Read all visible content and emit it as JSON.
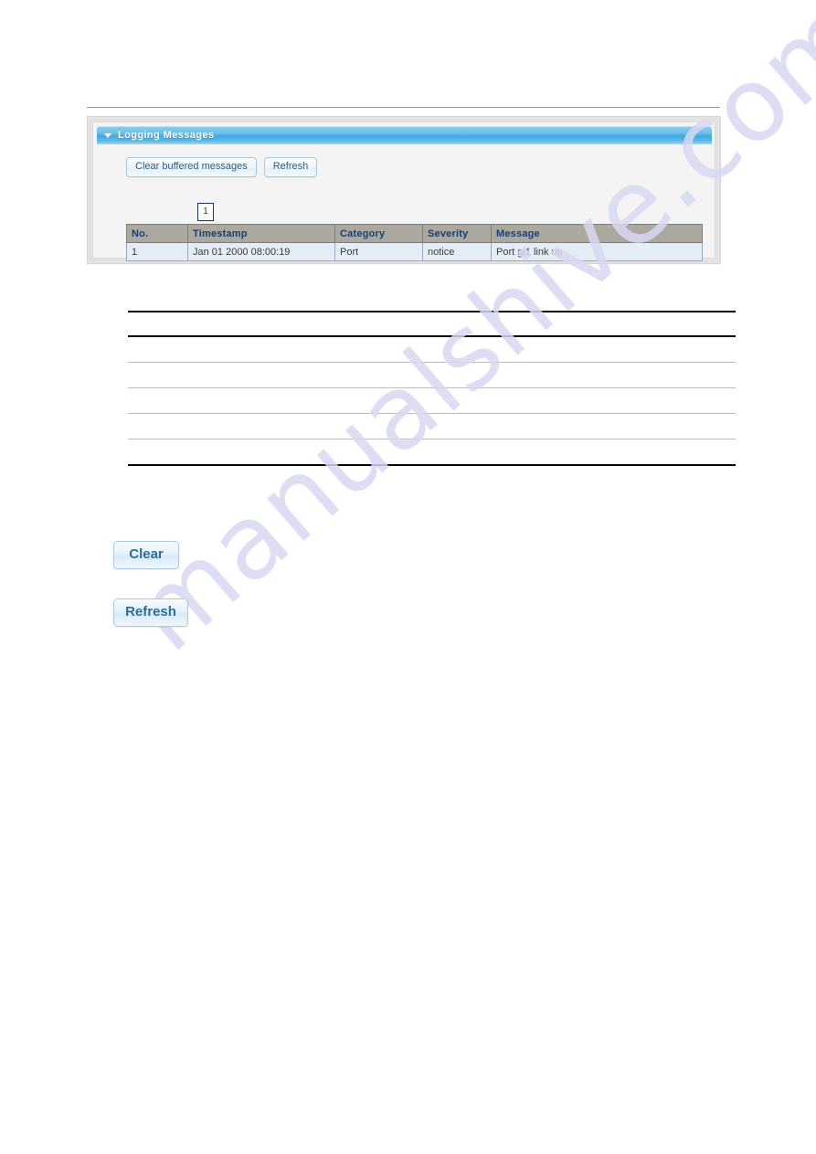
{
  "panel": {
    "title": "Logging Messages",
    "toggle_icon": "triangle-down-icon",
    "buttons": {
      "clear_buffered": "Clear buffered messages",
      "refresh": "Refresh"
    },
    "callout_number": "1",
    "table": {
      "headers": [
        "No.",
        "Timestamp",
        "Category",
        "Severity",
        "Message"
      ],
      "rows": [
        {
          "no": "1",
          "timestamp": "Jan 01 2000 08:00:19",
          "category": "Port",
          "severity": "notice",
          "message": "Port gi1 link up"
        }
      ]
    }
  },
  "description_table": {
    "headers": [],
    "rows": [
      [],
      [],
      [],
      []
    ]
  },
  "bottom_buttons": {
    "clear": "Clear",
    "refresh": "Refresh"
  },
  "watermark": {
    "text": "manualshive.com"
  },
  "colors": {
    "title_bar_accent": "#3fa9e0",
    "table_header_bg": "#aaa89f",
    "table_header_text": "#163f73",
    "table_row_bg": "#e4edf6",
    "button_text": "#2d6c9a",
    "watermark": "#d8d8f2"
  }
}
